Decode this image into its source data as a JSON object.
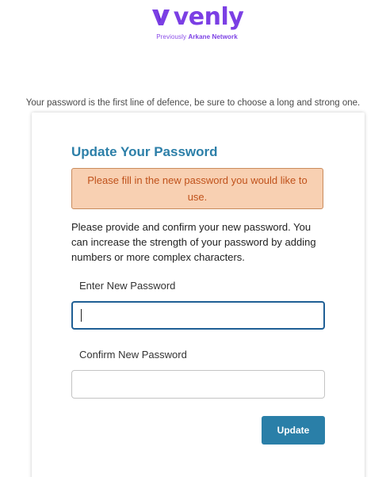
{
  "brand": {
    "name": "venly",
    "subtitle_prefix": "Previously",
    "subtitle_name": "Arkane Network",
    "color": "#7b3fe4"
  },
  "tagline": "Your password is the first line of defence, be sure to choose a long and strong one.",
  "card": {
    "title": "Update Your Password",
    "alert": "Please fill in the new password you would like to use.",
    "instructions": "Please provide and confirm your new password. You can increase the strength of your password by adding numbers or more complex characters.",
    "new_password": {
      "label": "Enter New Password",
      "value": ""
    },
    "confirm_password": {
      "label": "Confirm New Password",
      "value": ""
    },
    "submit_label": "Update"
  },
  "colors": {
    "title": "#2c7fa8",
    "button": "#2a7fa8",
    "alert_bg": "#f8d0b2",
    "alert_text": "#c0521b",
    "focus_border": "#1f5f95"
  }
}
